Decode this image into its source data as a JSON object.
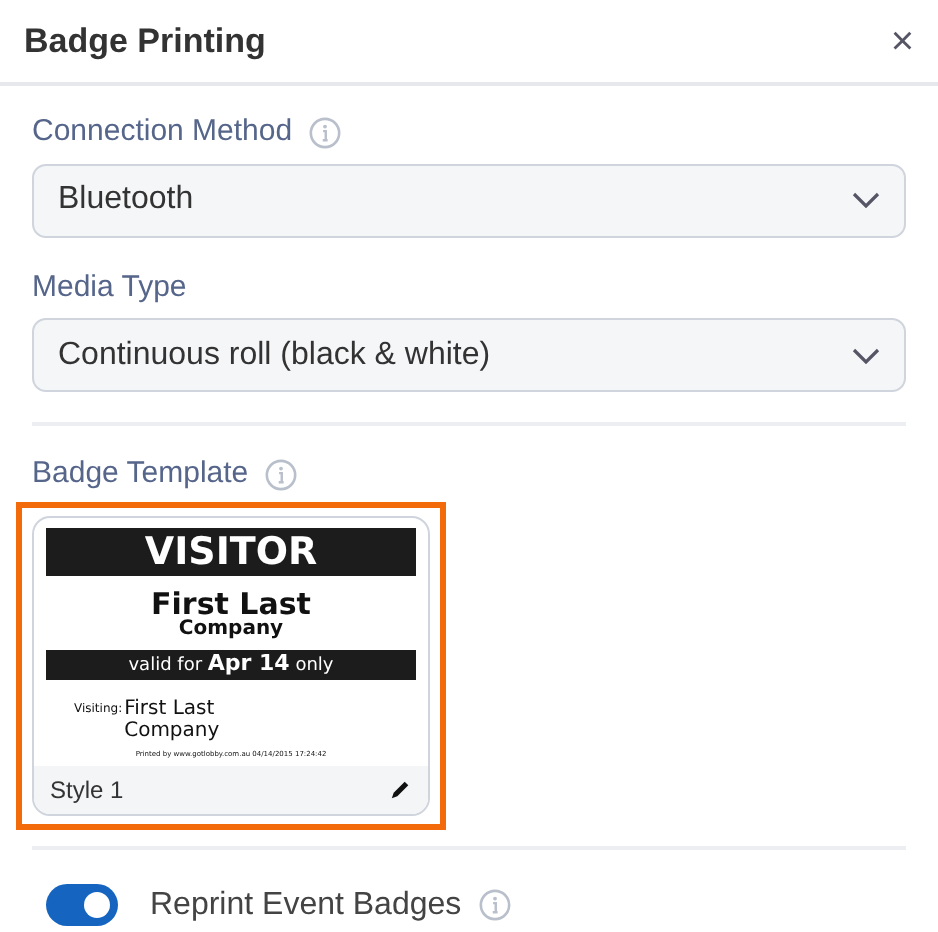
{
  "window": {
    "title": "Badge Printing",
    "close": "×"
  },
  "fields": [
    {
      "label": "Connection Method",
      "info": true,
      "value": "Bluetooth"
    },
    {
      "label": "Media Type",
      "info": false,
      "value": "Continuous roll (black & white)"
    }
  ],
  "badge_template": {
    "label": "Badge Template",
    "templates": [
      {
        "name": "Style 1",
        "selected": true,
        "badge": {
          "heading": "VISITOR",
          "name": "First Last",
          "company": "Company",
          "validity": "valid for **Apr 14** only",
          "visiting_label": "Visiting:",
          "visiting_name": "First Last",
          "visiting_company": "Company",
          "footer": "Printed by www.gotlobby.com.au 04/14/2015 17:24:42"
        }
      }
    ]
  },
  "reprint": {
    "label": "Reprint Event Badges",
    "on": true
  }
}
